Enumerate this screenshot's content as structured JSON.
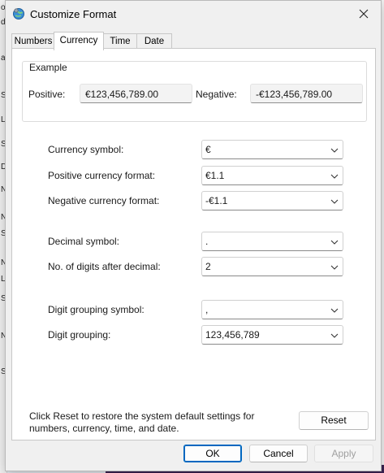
{
  "window": {
    "title": "Customize Format"
  },
  "tabs": [
    {
      "label": "Numbers"
    },
    {
      "label": "Currency"
    },
    {
      "label": "Time"
    },
    {
      "label": "Date"
    }
  ],
  "example": {
    "group_label": "Example",
    "positive_label": "Positive:",
    "positive_value": "€123,456,789.00",
    "negative_label": "Negative:",
    "negative_value": "-€123,456,789.00"
  },
  "settings": [
    {
      "label": "Currency symbol:",
      "value": "€"
    },
    {
      "label": "Positive currency format:",
      "value": "€1.1"
    },
    {
      "label": "Negative currency format:",
      "value": "-€1.1"
    },
    {
      "label": "Decimal symbol:",
      "value": "."
    },
    {
      "label": "No. of digits after decimal:",
      "value": "2"
    },
    {
      "label": "Digit grouping symbol:",
      "value": ","
    },
    {
      "label": "Digit grouping:",
      "value": "123,456,789"
    }
  ],
  "footer": {
    "reset_note": "Click Reset to restore the system default settings for numbers, currency, time, and date.",
    "reset_label": "Reset",
    "ok_label": "OK",
    "cancel_label": "Cancel",
    "apply_label": "Apply"
  },
  "background": {
    "left_fragments": [
      "o",
      "d",
      "a",
      "S",
      "L",
      "S",
      "D",
      "N",
      "N",
      "S",
      "N",
      "L",
      "S",
      "N",
      "S"
    ]
  },
  "colors": {
    "accent": "#0067c0",
    "panel": "#ffffff",
    "dialog": "#f0f0f0"
  }
}
